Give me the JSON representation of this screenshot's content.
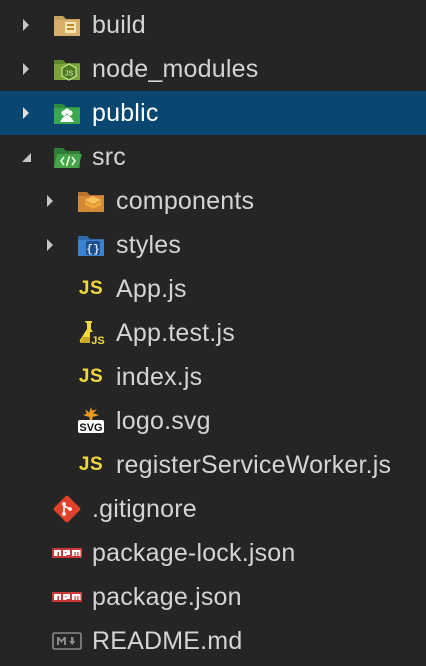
{
  "colors": {
    "background": "#252526",
    "selected_row": "#094771",
    "text": "#d4d4d4",
    "js_yellow": "#f1d93b",
    "npm_red": "#cb3837",
    "git_red": "#e2412a"
  },
  "tree": [
    {
      "label": "build",
      "icon": "folder-build-icon",
      "expanded": false,
      "selected": false
    },
    {
      "label": "node_modules",
      "icon": "folder-node-icon",
      "expanded": false,
      "selected": false
    },
    {
      "label": "public",
      "icon": "folder-public-icon",
      "expanded": false,
      "selected": true
    },
    {
      "label": "src",
      "icon": "folder-src-icon",
      "expanded": true,
      "selected": false,
      "children": [
        {
          "label": "components",
          "icon": "folder-components-icon",
          "expanded": false
        },
        {
          "label": "styles",
          "icon": "folder-styles-icon",
          "expanded": false
        },
        {
          "label": "App.js",
          "icon": "js-file-icon",
          "icon_text": "JS"
        },
        {
          "label": "App.test.js",
          "icon": "js-test-file-icon",
          "icon_text": "JS"
        },
        {
          "label": "index.js",
          "icon": "js-file-icon",
          "icon_text": "JS"
        },
        {
          "label": "logo.svg",
          "icon": "svg-file-icon",
          "icon_text": "SVG"
        },
        {
          "label": "registerServiceWorker.js",
          "icon": "js-file-icon",
          "icon_text": "JS"
        }
      ]
    },
    {
      "label": ".gitignore",
      "icon": "git-file-icon"
    },
    {
      "label": "package-lock.json",
      "icon": "npm-file-icon",
      "icon_text": "npm"
    },
    {
      "label": "package.json",
      "icon": "npm-file-icon",
      "icon_text": "npm"
    },
    {
      "label": "README.md",
      "icon": "markdown-file-icon",
      "icon_text": "M↓"
    }
  ]
}
